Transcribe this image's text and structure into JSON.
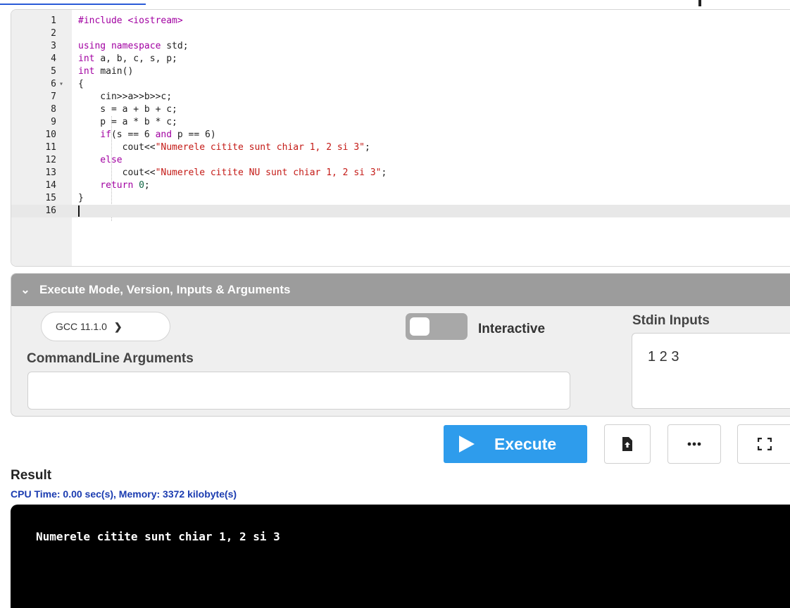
{
  "editor": {
    "lines": [
      {
        "n": "1",
        "fold": "",
        "tokens": [
          {
            "t": "#include <iostream>",
            "c": "kw"
          }
        ]
      },
      {
        "n": "2",
        "fold": "",
        "tokens": []
      },
      {
        "n": "3",
        "fold": "",
        "tokens": [
          {
            "t": "using namespace ",
            "c": "kw"
          },
          {
            "t": "std;",
            "c": "plain"
          }
        ]
      },
      {
        "n": "4",
        "fold": "",
        "tokens": [
          {
            "t": "int ",
            "c": "kw"
          },
          {
            "t": "a, b, c, s, p;",
            "c": "plain"
          }
        ]
      },
      {
        "n": "5",
        "fold": "",
        "tokens": [
          {
            "t": "int ",
            "c": "kw"
          },
          {
            "t": "main()",
            "c": "plain"
          }
        ]
      },
      {
        "n": "6",
        "fold": "▾",
        "tokens": [
          {
            "t": "{",
            "c": "plain"
          }
        ]
      },
      {
        "n": "7",
        "fold": "",
        "tokens": [
          {
            "t": "    cin>>a>>b>>c;",
            "c": "plain"
          }
        ]
      },
      {
        "n": "8",
        "fold": "",
        "tokens": [
          {
            "t": "    s = a + b + c;",
            "c": "plain"
          }
        ]
      },
      {
        "n": "9",
        "fold": "",
        "tokens": [
          {
            "t": "    p = a * b * c;",
            "c": "plain"
          }
        ]
      },
      {
        "n": "10",
        "fold": "",
        "tokens": [
          {
            "t": "    if",
            "c": "kw"
          },
          {
            "t": "(s == 6 ",
            "c": "plain"
          },
          {
            "t": "and",
            "c": "kw"
          },
          {
            "t": " p == 6)",
            "c": "plain"
          }
        ]
      },
      {
        "n": "11",
        "fold": "",
        "tokens": [
          {
            "t": "        cout<<",
            "c": "plain"
          },
          {
            "t": "\"Numerele citite sunt chiar 1, 2 si 3\"",
            "c": "str"
          },
          {
            "t": ";",
            "c": "plain"
          }
        ]
      },
      {
        "n": "12",
        "fold": "",
        "tokens": [
          {
            "t": "    else",
            "c": "kw"
          }
        ]
      },
      {
        "n": "13",
        "fold": "",
        "tokens": [
          {
            "t": "        cout<<",
            "c": "plain"
          },
          {
            "t": "\"Numerele citite NU sunt chiar 1, 2 si 3\"",
            "c": "str"
          },
          {
            "t": ";",
            "c": "plain"
          }
        ]
      },
      {
        "n": "14",
        "fold": "",
        "tokens": [
          {
            "t": "    return ",
            "c": "kw"
          },
          {
            "t": "0",
            "c": "num"
          },
          {
            "t": ";",
            "c": "plain"
          }
        ]
      },
      {
        "n": "15",
        "fold": "",
        "tokens": [
          {
            "t": "}",
            "c": "plain"
          }
        ]
      },
      {
        "n": "16",
        "fold": "",
        "tokens": [],
        "active": true
      }
    ]
  },
  "exec_panel": {
    "header": "Execute Mode, Version, Inputs & Arguments",
    "compiler": "GCC 11.1.0",
    "interactive_label": "Interactive",
    "interactive_on": false,
    "cmdline_label": "CommandLine Arguments",
    "cmdline_value": "",
    "stdin_label": "Stdin Inputs",
    "stdin_value": "1 2 3"
  },
  "toolbar": {
    "execute_label": "Execute",
    "save_icon": "file-upload-icon",
    "more_icon": "ellipsis-icon",
    "fullscreen_icon": "fullscreen-icon"
  },
  "result": {
    "label": "Result",
    "stats": "CPU Time: 0.00 sec(s), Memory: 3372 kilobyte(s)",
    "output": "Numerele citite sunt chiar 1, 2 si 3"
  },
  "colors": {
    "execute_button": "#2e9cec",
    "header_bar": "#9c9c9c",
    "keyword": "#a100a1",
    "string": "#c41a16"
  }
}
